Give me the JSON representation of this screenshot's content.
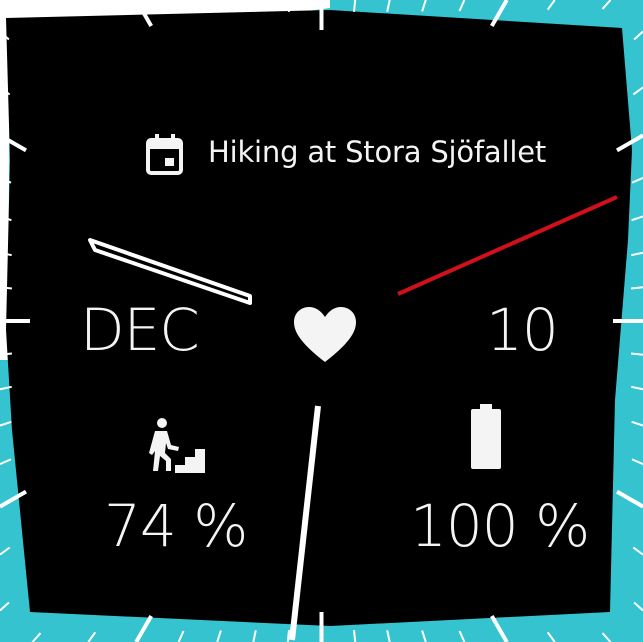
{
  "watch_face": {
    "event": {
      "text": "Hiking at Stora Sjöfallet",
      "icon": "calendar-icon"
    },
    "date": {
      "month": "DEC",
      "day": "10"
    },
    "center_icon": "heart-icon",
    "steps": {
      "value": "74 %",
      "icon": "stairs-climber-icon"
    },
    "battery": {
      "value": "100 %",
      "icon": "battery-icon",
      "level": 1.0
    },
    "colors": {
      "face": "#000000",
      "bezel_accent": "#35c3d0",
      "ticks": "#ffffff",
      "second_hand": "#d0101a",
      "text": "#f4f4f4"
    }
  }
}
